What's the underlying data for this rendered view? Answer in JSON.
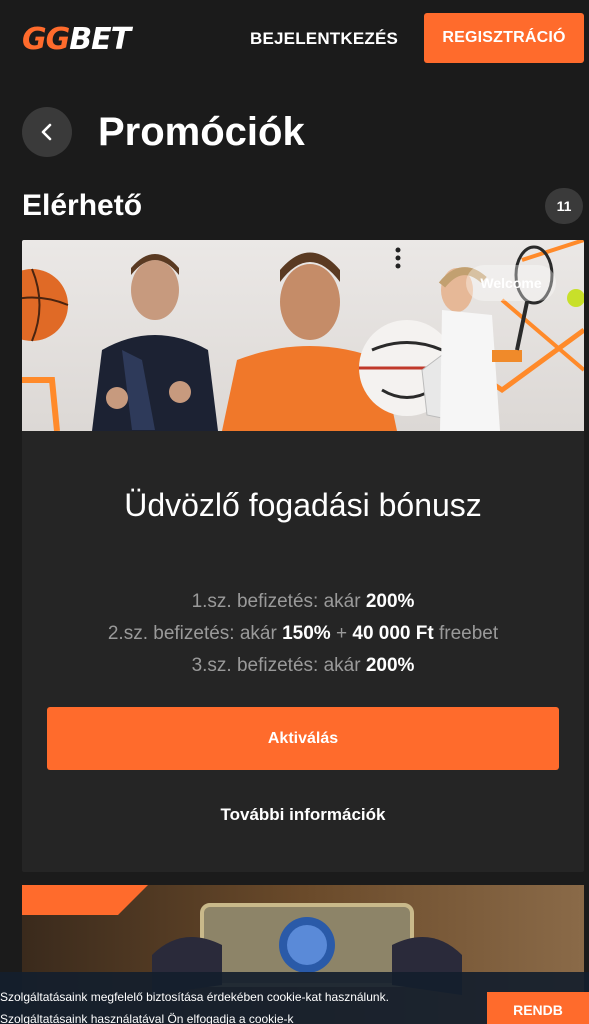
{
  "header": {
    "logo_gg": "GG",
    "logo_bet": "BET",
    "login_label": "BEJELENTKEZÉS",
    "register_label": "REGISZTRÁCIÓ"
  },
  "page": {
    "title": "Promóciók",
    "section_title": "Elérhető",
    "count": "11"
  },
  "promo": {
    "banner_tag": "Welcome",
    "title": "Üdvözlő fogadási bónusz",
    "lines": [
      {
        "prefix": "1.sz. befizetés: akár ",
        "bold1": "200%",
        "mid": "",
        "bold2": "",
        "suffix": ""
      },
      {
        "prefix": "2.sz. befizetés: akár ",
        "bold1": "150%",
        "mid": " + ",
        "bold2": "40 000 Ft",
        "suffix": " freebet"
      },
      {
        "prefix": "3.sz. befizetés: akár ",
        "bold1": "200%",
        "mid": "",
        "bold2": "",
        "suffix": ""
      }
    ],
    "activate_label": "Aktiválás",
    "more_info_label": "További információk"
  },
  "cookie": {
    "line1": "Szolgáltatásaink megfelelő biztosítása érdekében cookie-kat használunk.",
    "line2": "Szolgáltatásaink használatával Ön elfogadja a cookie-k",
    "button_label": "RENDB"
  },
  "colors": {
    "accent": "#ff6b2c",
    "background": "#1b1b1b",
    "card": "#252525"
  }
}
